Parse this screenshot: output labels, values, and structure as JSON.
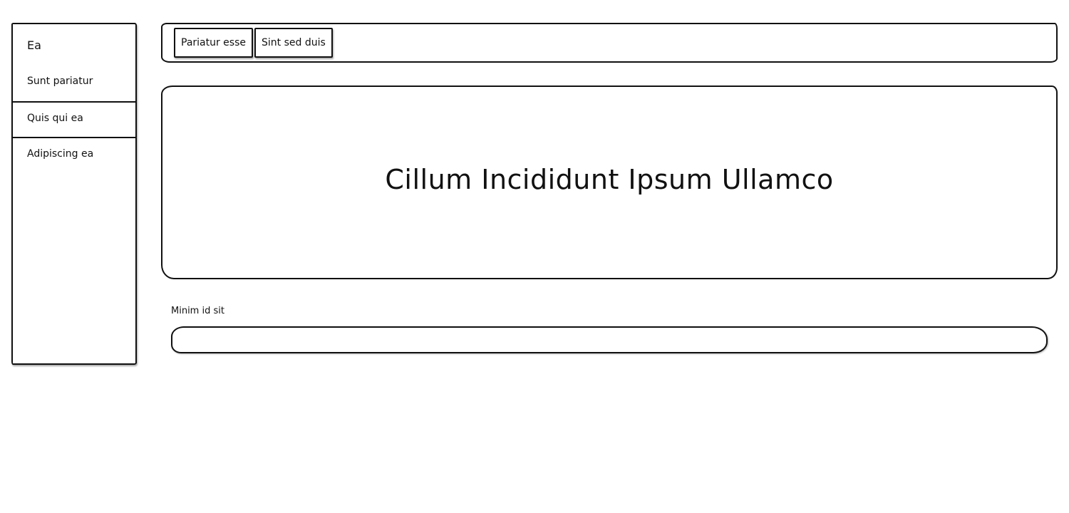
{
  "sidebar": {
    "title": "Ea",
    "items": [
      {
        "label": "Sunt pariatur"
      },
      {
        "label": "Quis qui ea"
      },
      {
        "label": "Adipiscing ea"
      }
    ]
  },
  "topbar": {
    "tabs": [
      {
        "label": "Pariatur esse"
      },
      {
        "label": "Sint sed duis"
      }
    ]
  },
  "hero": {
    "title": "Cillum Incididunt Ipsum Ullamco"
  },
  "form": {
    "field_label": "Minim id sit",
    "field_value": "",
    "field_placeholder": ""
  }
}
